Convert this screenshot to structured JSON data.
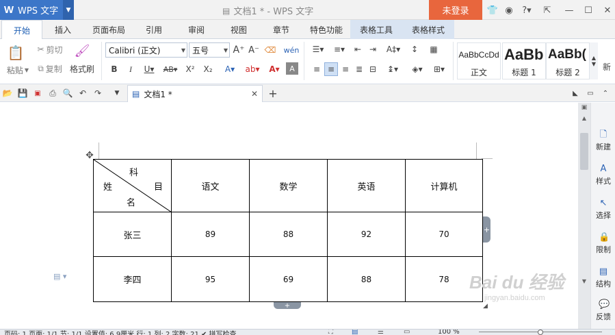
{
  "app": {
    "name": "WPS 文字",
    "doc_title": "文档1 * - WPS 文字",
    "login": "未登录"
  },
  "tabs": [
    {
      "label": "开始"
    },
    {
      "label": "插入"
    },
    {
      "label": "页面布局"
    },
    {
      "label": "引用"
    },
    {
      "label": "审阅"
    },
    {
      "label": "视图"
    },
    {
      "label": "章节"
    },
    {
      "label": "特色功能"
    },
    {
      "label": "表格工具"
    },
    {
      "label": "表格样式"
    }
  ],
  "ribbon": {
    "paste": "粘贴",
    "cut": "剪切",
    "copy": "复制",
    "format_painter": "格式刷",
    "font_name": "Calibri (正文)",
    "font_size": "五号",
    "styles": [
      {
        "preview": "AaBbCcDd",
        "label": "正文"
      },
      {
        "preview": "AaBb",
        "label": "标题 1"
      },
      {
        "preview": "AaBb(",
        "label": "标题 2"
      }
    ],
    "new_style": "新"
  },
  "doc_tab": {
    "label": "文档1 *"
  },
  "table": {
    "header_diag": {
      "top": "科",
      "right": "目",
      "left": "姓",
      "bottom": "名"
    },
    "columns": [
      "语文",
      "数学",
      "英语",
      "计算机"
    ],
    "rows": [
      {
        "name": "张三",
        "scores": [
          "89",
          "88",
          "92",
          "70"
        ]
      },
      {
        "name": "李四",
        "scores": [
          "95",
          "69",
          "88",
          "78"
        ]
      }
    ]
  },
  "side_panel": [
    "新建",
    "样式",
    "选择",
    "限制",
    "结构",
    "反馈"
  ],
  "status": {
    "text": "页码: 1  页面: 1/1  节: 1/1  设置值: 6.9厘米  行: 1  列: 2  字数: 21  ✔ 拼写检查",
    "zoom": "100 %"
  },
  "watermark": {
    "text": "Bai du 经验",
    "url": "jingyan.baidu.com"
  }
}
